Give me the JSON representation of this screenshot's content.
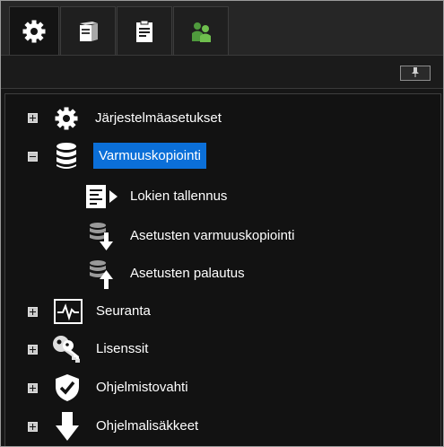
{
  "tabs": [
    {
      "name": "gear-icon",
      "active": true
    },
    {
      "name": "server-icon",
      "active": false
    },
    {
      "name": "clipboard-icon",
      "active": false
    },
    {
      "name": "users-icon",
      "active": false
    }
  ],
  "toolbar": {
    "pin_icon": "pin-icon"
  },
  "tree": {
    "items": [
      {
        "label": "Järjestelmäasetukset",
        "icon": "gear-icon",
        "state": "collapsed"
      },
      {
        "label": "Varmuuskopiointi",
        "icon": "database-icon",
        "state": "expanded",
        "selected": true,
        "children": [
          {
            "label": "Lokien tallennus",
            "icon": "log-save-icon"
          },
          {
            "label": "Asetusten varmuuskopiointi",
            "icon": "backup-down-icon"
          },
          {
            "label": "Asetusten palautus",
            "icon": "restore-up-icon"
          }
        ]
      },
      {
        "label": "Seuranta",
        "icon": "monitor-icon",
        "state": "collapsed"
      },
      {
        "label": "Lisenssit",
        "icon": "keys-icon",
        "state": "collapsed"
      },
      {
        "label": "Ohjelmistovahti",
        "icon": "shield-check-icon",
        "state": "collapsed"
      },
      {
        "label": "Ohjelmalisäkkeet",
        "icon": "download-arrow-icon",
        "state": "collapsed"
      }
    ]
  },
  "colors": {
    "selection": "#0b6fd8",
    "panel": "#121212",
    "tabbar": "#262626",
    "users_icon": "#4f9a3d"
  }
}
